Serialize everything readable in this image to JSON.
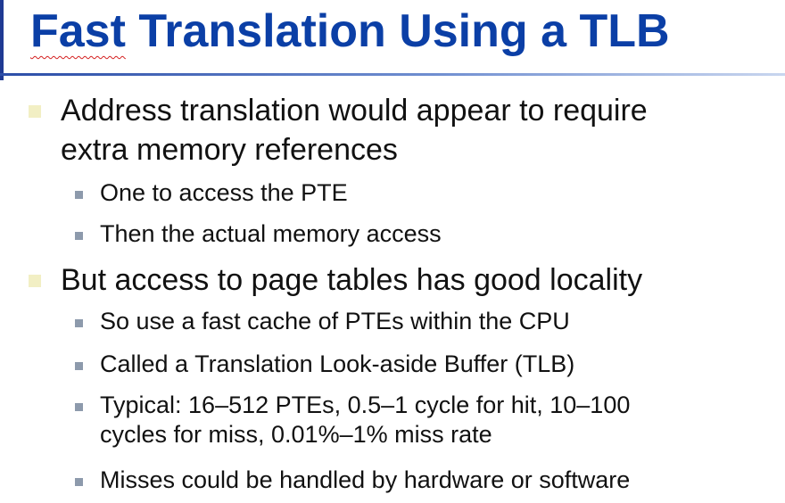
{
  "slide": {
    "title_first_word": "Fast",
    "title_rest": " Translation Using a TLB",
    "bullets": [
      {
        "text_line1": "Address translation would appear to require",
        "text_line2": "extra memory references",
        "subs": [
          {
            "text": "One to access the PTE"
          },
          {
            "text": "Then the actual memory access"
          }
        ]
      },
      {
        "text_line1": "But access to page tables has good locality",
        "subs": [
          {
            "text": "So use a fast cache of PTEs within the CPU"
          },
          {
            "text": "Called a Translation Look-aside Buffer (TLB)"
          },
          {
            "text_line1": "Typical: 16–512 PTEs, 0.5–1 cycle for hit, 10–100",
            "text_line2": "cycles for miss, 0.01%–1% miss rate"
          },
          {
            "text": "Misses could be handled by hardware or software"
          }
        ]
      }
    ]
  },
  "colors": {
    "title": "#0b3fa6",
    "body_text": "#111111",
    "level1_bullet": "#f2efc4",
    "level2_bullet": "#8d9aac"
  }
}
